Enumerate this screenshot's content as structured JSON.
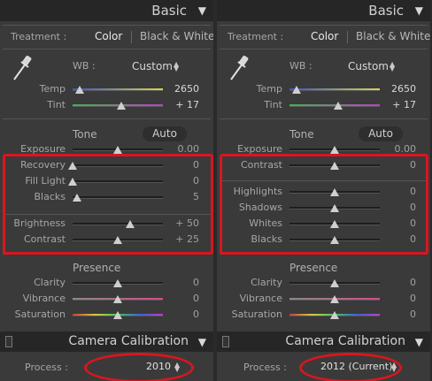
{
  "panels": [
    {
      "header": {
        "title": "Basic"
      },
      "treatment": {
        "label": "Treatment :",
        "options": [
          "Color",
          "Black & White"
        ],
        "selected": "Color"
      },
      "wb": {
        "label": "WB :",
        "value": "Custom"
      },
      "tone_label": "Tone",
      "auto_label": "Auto",
      "sliders": [
        {
          "label": "Temp",
          "value": "2650",
          "level": 0.08,
          "group": "wb"
        },
        {
          "label": "Tint",
          "value": "+ 17",
          "level": 0.54,
          "group": "wb"
        },
        {
          "label": "Exposure",
          "value": "0.00",
          "level": 0.5,
          "group": "tone"
        },
        {
          "label": "Recovery",
          "value": "0",
          "level": 0.0,
          "group": "tone"
        },
        {
          "label": "Fill Light",
          "value": "0",
          "level": 0.0,
          "group": "tone"
        },
        {
          "label": "Blacks",
          "value": "5",
          "level": 0.05,
          "group": "tone"
        },
        {
          "label": "Brightness",
          "value": "+ 50",
          "level": 0.64,
          "group": "tone"
        },
        {
          "label": "Contrast",
          "value": "+ 25",
          "level": 0.5,
          "group": "tone"
        },
        {
          "label": "Clarity",
          "value": "0",
          "level": 0.5,
          "group": "presence"
        },
        {
          "label": "Vibrance",
          "value": "0",
          "level": 0.5,
          "group": "presence"
        },
        {
          "label": "Saturation",
          "value": "0",
          "level": 0.5,
          "group": "presence"
        }
      ],
      "presence_label": "Presence",
      "camera_calibration": {
        "title": "Camera Calibration",
        "process_label": "Process :",
        "process_value": "2010"
      }
    },
    {
      "header": {
        "title": "Basic"
      },
      "treatment": {
        "label": "Treatment :",
        "options": [
          "Color",
          "Black & White"
        ],
        "selected": "Color"
      },
      "wb": {
        "label": "WB :",
        "value": "Custom"
      },
      "tone_label": "Tone",
      "auto_label": "Auto",
      "sliders": [
        {
          "label": "Temp",
          "value": "2650",
          "level": 0.08,
          "group": "wb"
        },
        {
          "label": "Tint",
          "value": "+ 17",
          "level": 0.54,
          "group": "wb"
        },
        {
          "label": "Exposure",
          "value": "0.00",
          "level": 0.5,
          "group": "tone"
        },
        {
          "label": "Contrast",
          "value": "0",
          "level": 0.5,
          "group": "tone"
        },
        {
          "label": "Highlights",
          "value": "0",
          "level": 0.5,
          "group": "tone"
        },
        {
          "label": "Shadows",
          "value": "0",
          "level": 0.5,
          "group": "tone"
        },
        {
          "label": "Whites",
          "value": "0",
          "level": 0.5,
          "group": "tone"
        },
        {
          "label": "Blacks",
          "value": "0",
          "level": 0.5,
          "group": "tone"
        },
        {
          "label": "Clarity",
          "value": "0",
          "level": 0.5,
          "group": "presence"
        },
        {
          "label": "Vibrance",
          "value": "0",
          "level": 0.5,
          "group": "presence"
        },
        {
          "label": "Saturation",
          "value": "0",
          "level": 0.5,
          "group": "presence"
        }
      ],
      "presence_label": "Presence",
      "camera_calibration": {
        "title": "Camera Calibration",
        "process_label": "Process :",
        "process_value": "2012 (Current)"
      }
    }
  ],
  "colors": {
    "panel_bg": "#3a3a3a",
    "header_bg": "#262626",
    "highlight_red": "#d8161f",
    "temp_gradient": [
      "#3a55c8",
      "#d8d84a"
    ],
    "tint_gradient": [
      "#3fb84a",
      "#c040c8"
    ],
    "vibrance_gradient": [
      "#8a8a8a",
      "#d84a8a"
    ]
  }
}
